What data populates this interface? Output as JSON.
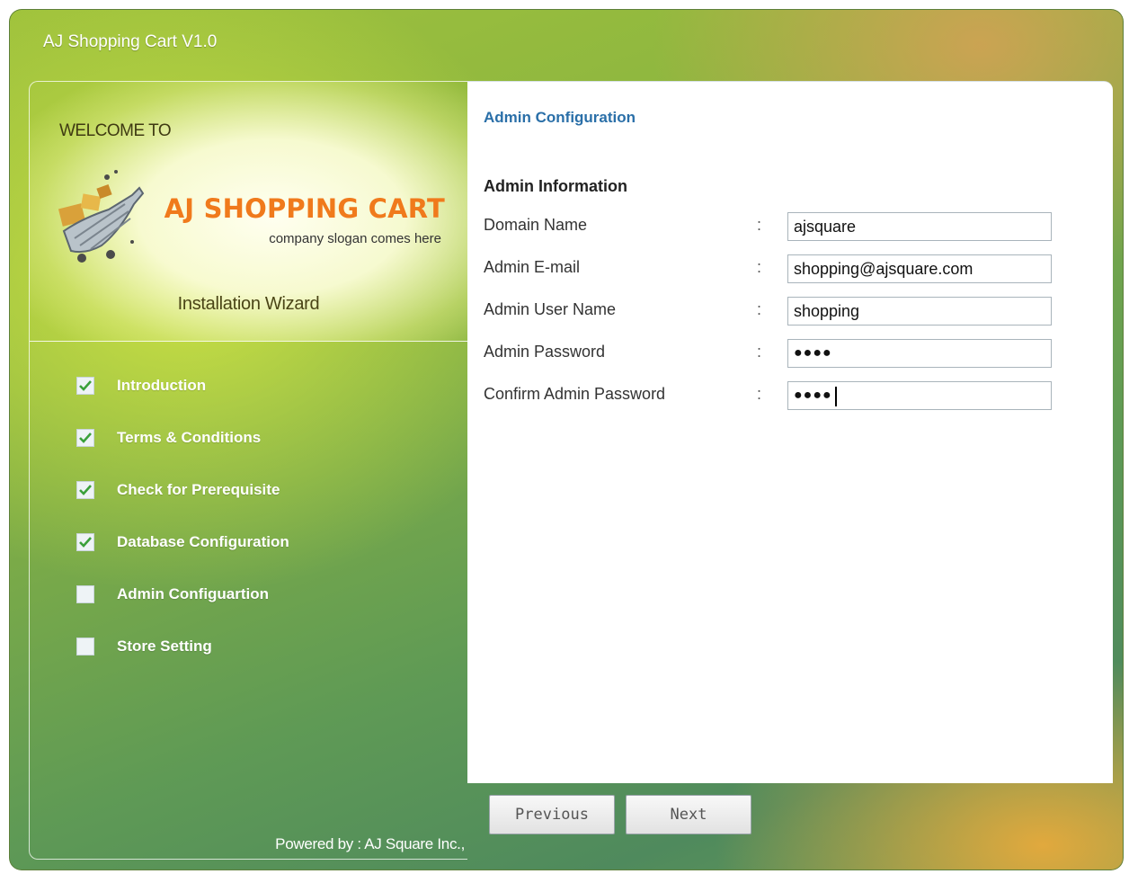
{
  "app": {
    "title": "AJ Shopping Cart V1.0"
  },
  "sidebar": {
    "welcome": "WELCOME TO",
    "brand_name": "AJ SHOPPING CART",
    "slogan": "company slogan comes here",
    "wizard_label": "Installation Wizard",
    "steps": [
      {
        "label": "Introduction",
        "checked": true
      },
      {
        "label": "Terms & Conditions",
        "checked": true
      },
      {
        "label": "Check for Prerequisite",
        "checked": true
      },
      {
        "label": "Database Configuration",
        "checked": true
      },
      {
        "label": "Admin Configuartion",
        "checked": false
      },
      {
        "label": "Store Setting",
        "checked": false
      }
    ],
    "powered_by": "Powered by : AJ Square Inc.,"
  },
  "main": {
    "section_title": "Admin Configuration",
    "subsection_title": "Admin Information",
    "separator": ":",
    "fields": [
      {
        "label": "Domain Name",
        "value": "ajsquare"
      },
      {
        "label": "Admin E-mail",
        "value": "shopping@ajsquare.com"
      },
      {
        "label": "Admin User Name",
        "value": "shopping"
      },
      {
        "label": "Admin Password",
        "value": "●●●●"
      },
      {
        "label": "Confirm Admin Password",
        "value": "●●●●"
      }
    ]
  },
  "footer": {
    "previous_label": "Previous",
    "next_label": "Next"
  },
  "colors": {
    "brand_orange": "#f07a1c",
    "section_title_blue": "#2a6fa8",
    "check_green": "#3aa03a"
  }
}
